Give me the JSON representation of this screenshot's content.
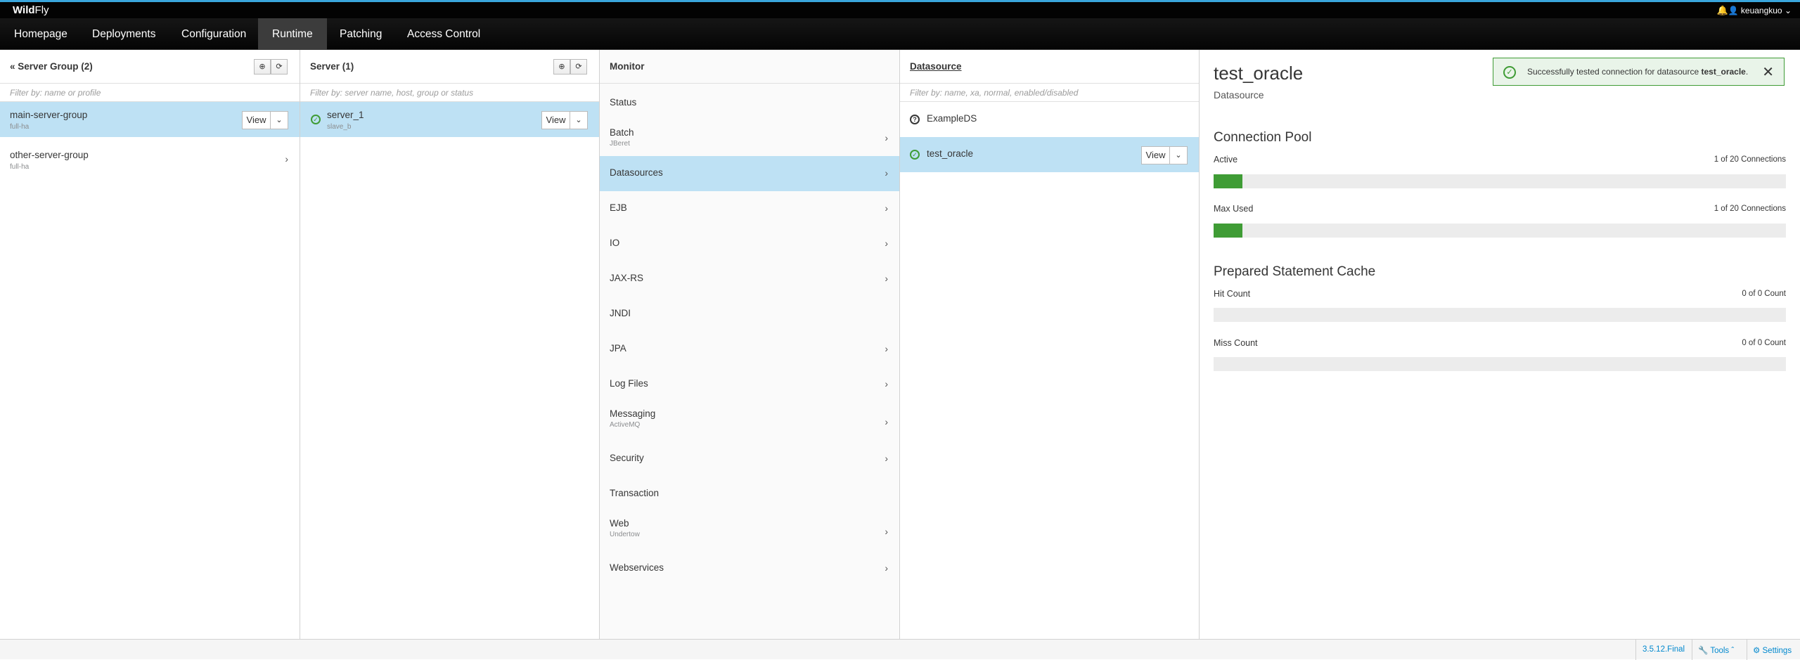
{
  "brand": {
    "bold": "Wild",
    "rest": "Fly"
  },
  "topbar": {
    "bell_icon": "bell-icon",
    "user": "keuangkuo"
  },
  "nav": [
    "Homepage",
    "Deployments",
    "Configuration",
    "Runtime",
    "Patching",
    "Access Control"
  ],
  "server_groups": {
    "title": "Server Group (2)",
    "filter": "Filter by: name or profile",
    "items": [
      {
        "name": "main-server-group",
        "sub": "full-ha"
      },
      {
        "name": "other-server-group",
        "sub": "full-ha"
      }
    ]
  },
  "servers": {
    "title": "Server (1)",
    "filter": "Filter by: server name, host, group or status",
    "items": [
      {
        "name": "server_1",
        "sub": "slave_b"
      }
    ]
  },
  "monitor": {
    "title": "Monitor",
    "items": [
      {
        "name": "Status",
        "sub": ""
      },
      {
        "name": "Batch",
        "sub": "JBeret"
      },
      {
        "name": "Datasources",
        "sub": ""
      },
      {
        "name": "EJB",
        "sub": ""
      },
      {
        "name": "IO",
        "sub": ""
      },
      {
        "name": "JAX-RS",
        "sub": ""
      },
      {
        "name": "JNDI",
        "sub": ""
      },
      {
        "name": "JPA",
        "sub": ""
      },
      {
        "name": "Log Files",
        "sub": ""
      },
      {
        "name": "Messaging",
        "sub": "ActiveMQ"
      },
      {
        "name": "Security",
        "sub": ""
      },
      {
        "name": "Transaction",
        "sub": ""
      },
      {
        "name": "Web",
        "sub": "Undertow"
      },
      {
        "name": "Webservices",
        "sub": ""
      }
    ]
  },
  "datasources": {
    "title": "Datasource",
    "filter": "Filter by: name, xa, normal, enabled/disabled",
    "items": [
      {
        "name": "ExampleDS"
      },
      {
        "name": "test_oracle"
      }
    ]
  },
  "view_label": "View",
  "detail": {
    "title": "test_oracle",
    "subtitle": "Datasource",
    "pool_title": "Connection Pool",
    "active_label": "Active",
    "active_value": "1 of 20 Connections",
    "active_fraction": 0.05,
    "maxused_label": "Max Used",
    "maxused_value": "1 of 20 Connections",
    "maxused_fraction": 0.05,
    "cache_title": "Prepared Statement Cache",
    "hit_label": "Hit Count",
    "hit_value": "0 of 0 Count",
    "miss_label": "Miss Count",
    "miss_value": "0 of 0 Count"
  },
  "toast": {
    "prefix": "Successfully tested connection for datasource ",
    "name": "test_oracle",
    "suffix": "."
  },
  "footer": {
    "version": "3.5.12.Final",
    "tools": "Tools",
    "settings": "Settings"
  }
}
